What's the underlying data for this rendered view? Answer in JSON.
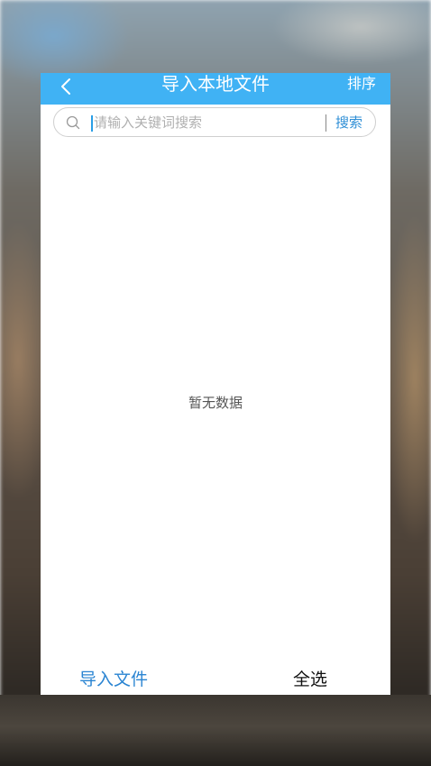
{
  "header": {
    "title": "导入本地文件",
    "sort_label": "排序",
    "back_icon": "chevron-left-icon",
    "background_color": "#40b2f4"
  },
  "search": {
    "placeholder": "请输入关键词搜索",
    "value": "",
    "button_label": "搜索",
    "icon": "search-icon"
  },
  "list": {
    "empty_message": "暂无数据"
  },
  "footer": {
    "import_label": "导入文件",
    "select_all_label": "全选",
    "accent_color": "#2a84d2"
  }
}
